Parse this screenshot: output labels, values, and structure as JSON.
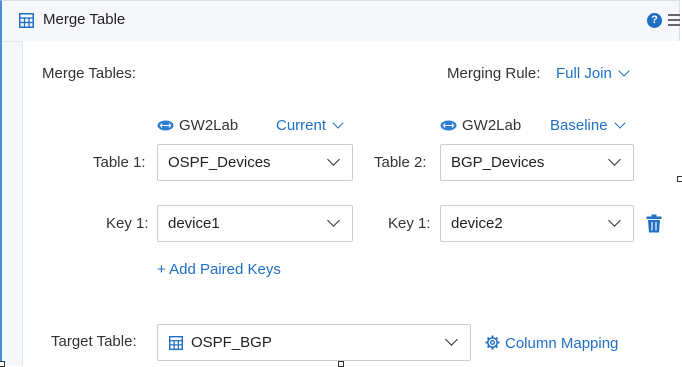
{
  "header": {
    "title": "Merge Table",
    "icons": [
      "table-icon",
      "help-icon",
      "menu-icon"
    ]
  },
  "form": {
    "merge_tables_label": "Merge Tables:",
    "merging_rule_label": "Merging Rule:",
    "merging_rule_value": "Full Join",
    "left": {
      "source_name": "GW2Lab",
      "source_version": "Current",
      "table_label": "Table 1:",
      "table_value": "OSPF_Devices",
      "key_label": "Key 1:",
      "key_value": "device1"
    },
    "right": {
      "source_name": "GW2Lab",
      "source_version": "Baseline",
      "table_label": "Table 2:",
      "table_value": "BGP_Devices",
      "key_label": "Key 1:",
      "key_value": "device2"
    },
    "add_keys_label": "+ Add Paired Keys",
    "target_label": "Target Table:",
    "target_value": "OSPF_BGP",
    "column_mapping_label": "Column Mapping"
  },
  "colors": {
    "accent": "#1f6fc5",
    "panel_border": "#4a90d9",
    "header_bg": "#f5f7fa"
  }
}
